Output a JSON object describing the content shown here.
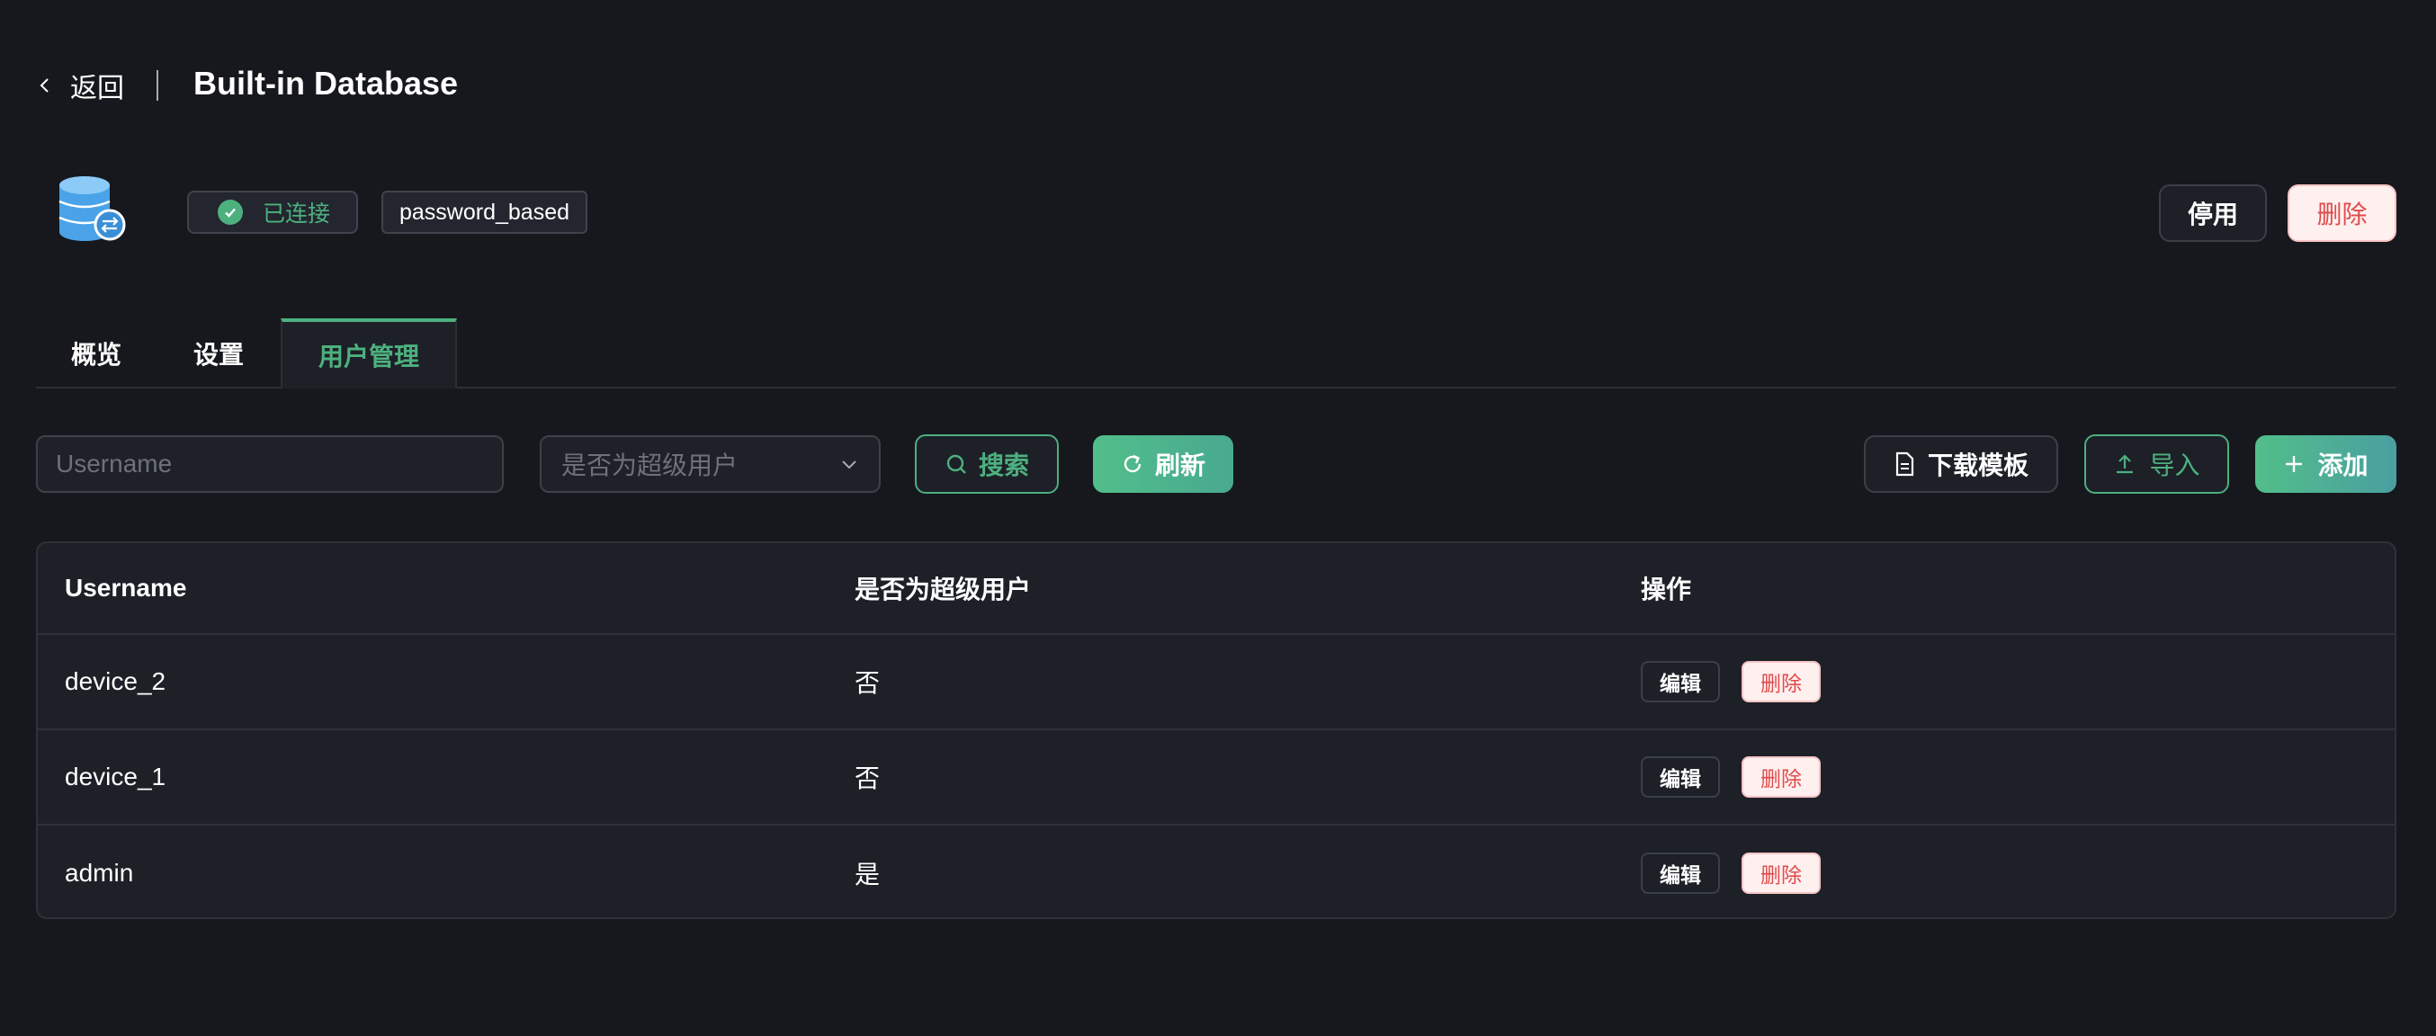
{
  "header": {
    "back_label": "返回",
    "title": "Built-in Database"
  },
  "resource": {
    "icon": "database-icon",
    "status": "已连接",
    "mechanism": "password_based",
    "disable_label": "停用",
    "delete_label": "删除"
  },
  "tabs": [
    {
      "label": "概览"
    },
    {
      "label": "设置"
    },
    {
      "label": "用户管理",
      "active": true
    }
  ],
  "toolbar": {
    "username_placeholder": "Username",
    "superuser_placeholder": "是否为超级用户",
    "search_label": "搜索",
    "refresh_label": "刷新",
    "download_template_label": "下载模板",
    "import_label": "导入",
    "add_label": "添加"
  },
  "table": {
    "columns": [
      "Username",
      "是否为超级用户",
      "操作"
    ],
    "rows": [
      {
        "username": "device_2",
        "is_superuser": "否",
        "edit": "编辑",
        "delete": "删除"
      },
      {
        "username": "device_1",
        "is_superuser": "否",
        "edit": "编辑",
        "delete": "删除"
      },
      {
        "username": "admin",
        "is_superuser": "是",
        "edit": "编辑",
        "delete": "删除"
      }
    ]
  },
  "colors": {
    "accent": "#4db07f",
    "danger": "#e04b4b",
    "background": "#16181d",
    "panel": "#1d2027"
  }
}
